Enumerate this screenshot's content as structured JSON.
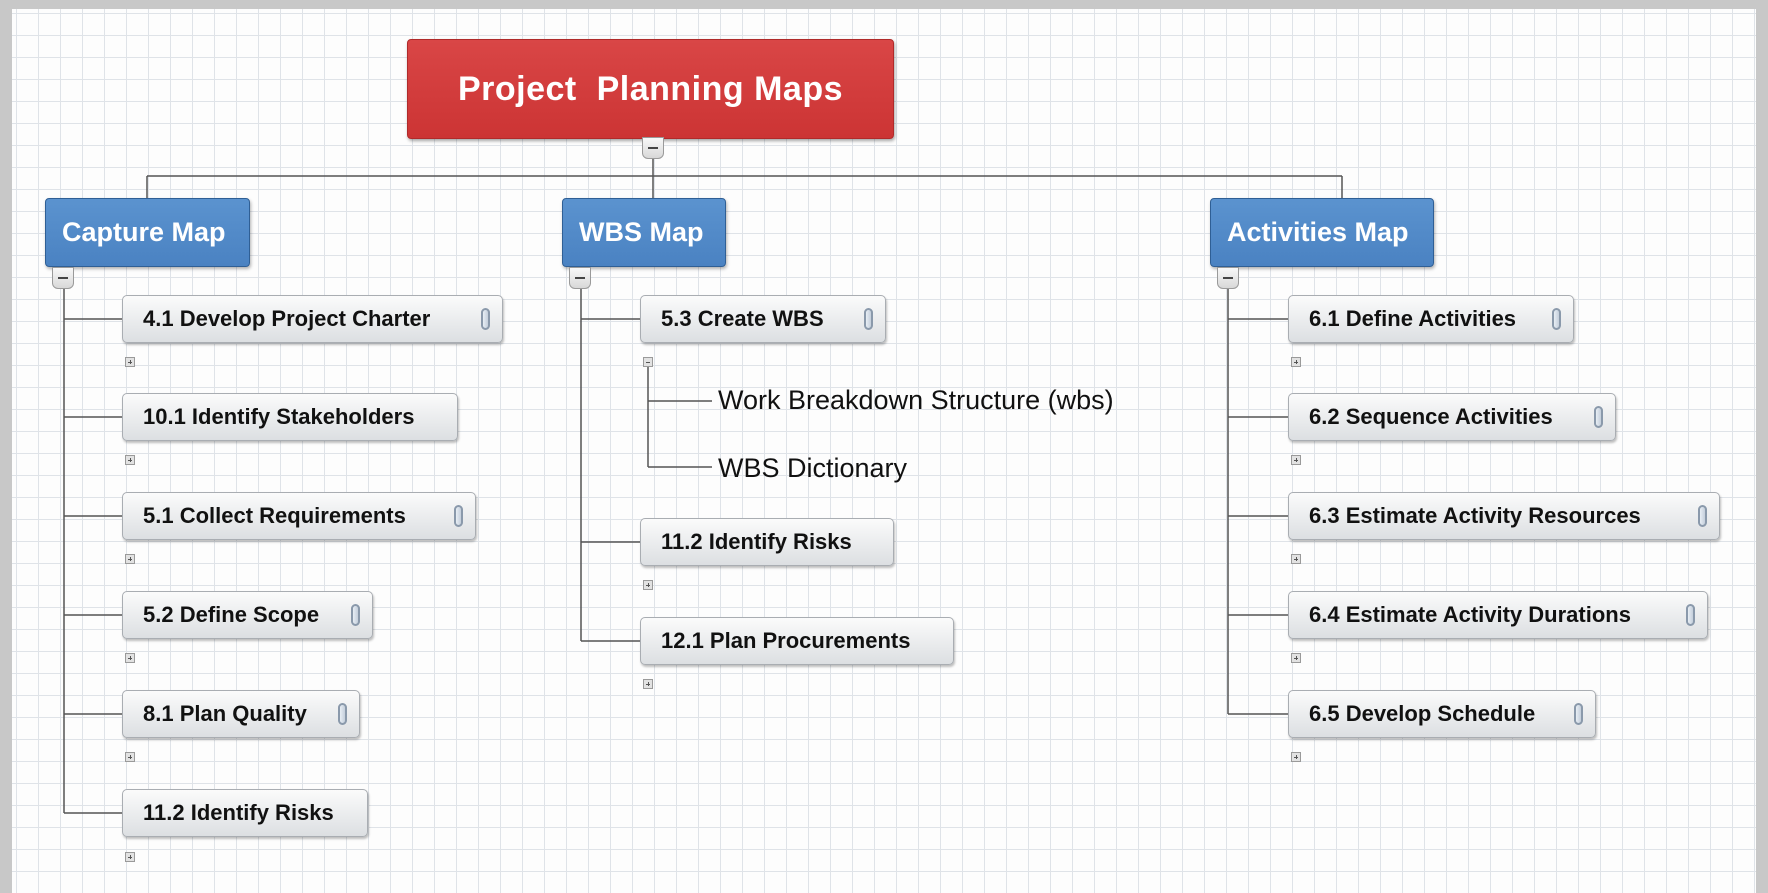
{
  "root": {
    "label": "Project  Planning Maps"
  },
  "branches": [
    {
      "label": "Capture Map",
      "topics": [
        {
          "label": "4.1 Develop Project Charter",
          "attachment": true
        },
        {
          "label": "10.1 Identify Stakeholders",
          "attachment": false
        },
        {
          "label": "5.1 Collect Requirements",
          "attachment": true
        },
        {
          "label": "5.2 Define Scope",
          "attachment": true
        },
        {
          "label": "8.1 Plan Quality",
          "attachment": true
        },
        {
          "label": "11.2 Identify Risks",
          "attachment": false
        }
      ]
    },
    {
      "label": "WBS Map",
      "topics": [
        {
          "label": "5.3 Create WBS",
          "attachment": true,
          "subtopics": [
            "Work Breakdown Structure (wbs)",
            "WBS Dictionary"
          ]
        },
        {
          "label": "11.2 Identify Risks",
          "attachment": false
        },
        {
          "label": "12.1 Plan Procurements",
          "attachment": false
        }
      ]
    },
    {
      "label": "Activities Map",
      "topics": [
        {
          "label": "6.1 Define Activities",
          "attachment": true
        },
        {
          "label": "6.2 Sequence Activities",
          "attachment": true
        },
        {
          "label": "6.3 Estimate Activity Resources",
          "attachment": true
        },
        {
          "label": "6.4 Estimate Activity Durations",
          "attachment": true
        },
        {
          "label": "6.5 Develop Schedule",
          "attachment": true
        }
      ]
    }
  ],
  "icons": {
    "attachment": "paperclip-icon",
    "collapse": "collapse-minus-icon",
    "expand": "expand-plus-icon"
  },
  "colors": {
    "root": "#d23c3c",
    "branch": "#4f88c6",
    "topic": "#e6e8ea",
    "connector": "#555555"
  }
}
